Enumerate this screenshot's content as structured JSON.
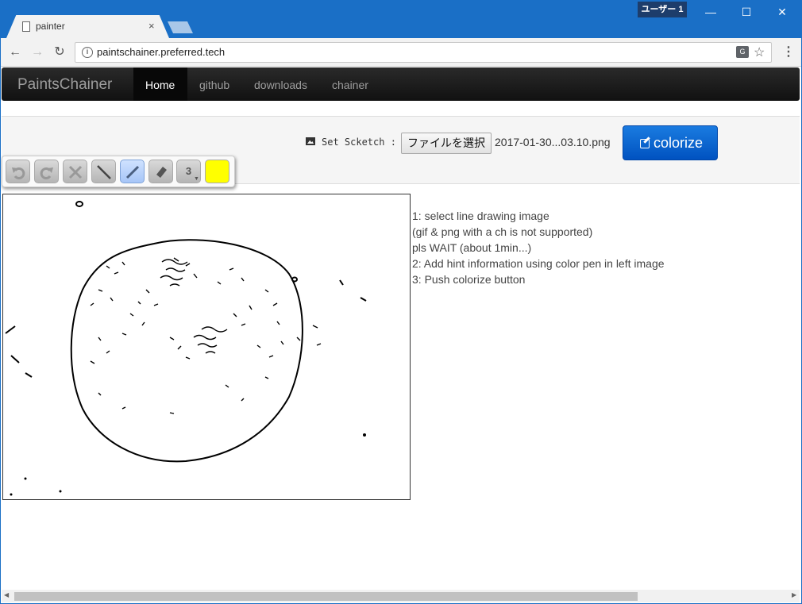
{
  "window": {
    "user_badge": "ユーザー 1",
    "minimize_glyph": "—",
    "maximize_glyph": "☐",
    "close_glyph": "✕"
  },
  "tab": {
    "title": "painter",
    "close_glyph": "×"
  },
  "toolbar": {
    "back_glyph": "←",
    "forward_glyph": "→",
    "reload_glyph": "↻",
    "info_glyph": "i",
    "url": "paintschainer.preferred.tech",
    "translate_glyph": "G",
    "star_glyph": "☆",
    "menu_glyph": "⋮"
  },
  "navbar": {
    "brand": "PaintsChainer",
    "links": [
      {
        "label": "Home",
        "active": true
      },
      {
        "label": "github",
        "active": false
      },
      {
        "label": "downloads",
        "active": false
      },
      {
        "label": "chainer",
        "active": false
      }
    ]
  },
  "controls": {
    "set_sketch_label": "Set Scketch :",
    "file_button_label": "ファイルを選択",
    "file_name": "2017-01-30...03.10.png",
    "colorize_label": "colorize"
  },
  "palette": {
    "tools": [
      {
        "name": "undo",
        "icon": "undo-icon"
      },
      {
        "name": "redo",
        "icon": "redo-icon"
      },
      {
        "name": "clear",
        "icon": "clear-icon"
      },
      {
        "name": "line",
        "icon": "line-icon"
      },
      {
        "name": "pen",
        "icon": "pen-icon",
        "selected": true
      },
      {
        "name": "eraser",
        "icon": "eraser-icon"
      }
    ],
    "brush_size": "3",
    "current_color": "#ffff00"
  },
  "instructions": [
    "1: select line drawing image",
    "(gif & png with a ch is not supported)",
    "pls WAIT (about 1min...)",
    "2: Add hint information using color pen in left image",
    "3: Push colorize button"
  ],
  "colors": {
    "titlebar": "#1a6fc6",
    "colorize_button": "#0a64d4",
    "navbar": "#1b1b1b"
  }
}
